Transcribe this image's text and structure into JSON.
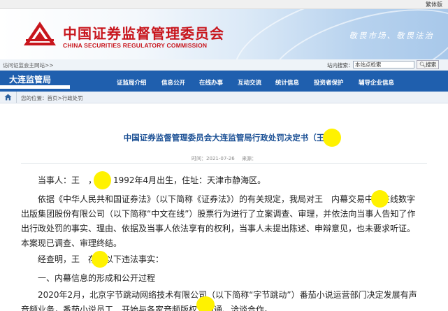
{
  "topbar": {
    "lang_toggle": "繁体版"
  },
  "header": {
    "org_name_cn": "中国证券监督管理委员会",
    "org_name_en": "CHINA SECURITIES REGULATORY COMMISSION",
    "slogan": "敬畏市场、敬畏法治"
  },
  "searchbar": {
    "visit_link": "访问证监会主网站>>",
    "search_label": "站内搜索：",
    "search_value": "本站点检索",
    "search_button": "搜索"
  },
  "nav": {
    "bureau_name": "大连监管局",
    "items": [
      {
        "label": "证监局介绍"
      },
      {
        "label": "信息公开"
      },
      {
        "label": "在线办事"
      },
      {
        "label": "互动交流"
      },
      {
        "label": "统计信息"
      },
      {
        "label": "投资者保护"
      },
      {
        "label": "辅导企业信息"
      }
    ]
  },
  "breadcrumb": {
    "text": "您的位置：首页>行政处罚"
  },
  "document": {
    "title": "中国证券监督管理委员会大连监管局行政处罚决定书（王",
    "time_label": "时间：2021-07-26",
    "source_label": "来源：",
    "paragraphs": [
      "当事人：王　，男，1992年4月出生，住址：天津市静海区。",
      "依据《中华人民共和国证券法》（以下简称《证券法》）的有关规定，我局对王　内幕交易中文在线数字出版集团股份有限公司（以下简称“中文在线”）股票行为进行了立案调查、审理，并依法向当事人告知了作出行政处罚的事实、理由、依据及当事人依法享有的权利，当事人未提出陈述、申辩意见，也未要求听证。本案现已调查、审理终结。",
      "经查明，王　存在以下违法事实：",
      "一、内幕信息的形成和公开过程",
      "2020年2月，北京字节跳动网络技术有限公司（以下简称“字节跳动”）番茄小说运营部门决定发展有声音频业务，番茄小说员工　开始与各家音频版权方沟通、洽谈合作。"
    ]
  },
  "colors": {
    "nav_blue": "#1f5fae",
    "brand_red": "#c8161d",
    "title_blue": "#1a4f94",
    "redaction_yellow": "#fff200"
  }
}
